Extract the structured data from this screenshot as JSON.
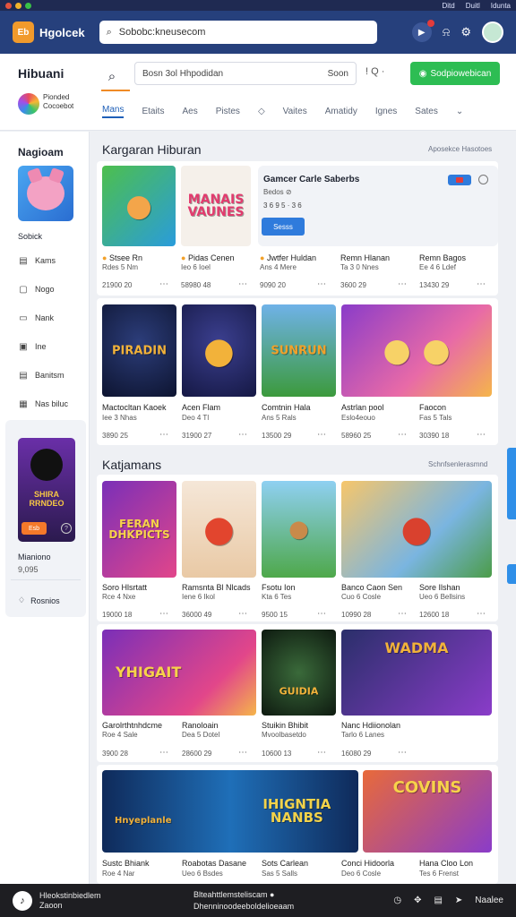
{
  "titlebar": {
    "items": [
      "Ditd",
      "Duitl",
      "Idunta"
    ],
    "traffic": [
      "#e5533d",
      "#f2b32b",
      "#39c047"
    ]
  },
  "topbar": {
    "logo_badge": "Eb",
    "logo_text": "Hgolcek",
    "url": "Sobobc:kneusecom",
    "icons": [
      "play-icon",
      "bell-icon",
      "settings-icon",
      "avatar"
    ]
  },
  "header": {
    "brand": "Hibuani",
    "brand_sub_1": "Pionded",
    "brand_sub_2": "Cocoebot",
    "search_placeholder": "Bosn  3ol  Hhpodidan",
    "search_right": "Soon",
    "mini": "! Q ·",
    "cta": "Sodpiowebican",
    "tabs": [
      "Mans",
      "Etaits",
      "Aes",
      "Pistes",
      "◇",
      "Vaites",
      "Amatidy",
      "Ignes",
      "Sates",
      "⌄"
    ]
  },
  "sidebar": {
    "title": "Nagioam",
    "sub": "Sobick",
    "items": [
      {
        "icon": "grid-icon",
        "glyph": "▤",
        "label": "Kams"
      },
      {
        "icon": "page-icon",
        "glyph": "▢",
        "label": "Nogo"
      },
      {
        "icon": "bookmark-icon",
        "glyph": "▭",
        "label": "Nank"
      },
      {
        "icon": "image-icon",
        "glyph": "▣",
        "label": "Ine"
      },
      {
        "icon": "box-icon",
        "glyph": "▤",
        "label": "Banitsm"
      },
      {
        "icon": "bag-icon",
        "glyph": "▦",
        "label": "Nas biluc"
      }
    ],
    "promo": {
      "title": "SHIRA RRNDEO",
      "button": "Esb",
      "name": "Mianiono",
      "meta": "9,095",
      "feedback": "Rosnios"
    }
  },
  "section1": {
    "title": "Kargaran Hiburan",
    "link": "Aposekce Hasotoes",
    "row1": [
      {
        "title": "Stsee Rn",
        "meta": "Rdes 5 Nm",
        "count": "21900 20",
        "art": "FOX"
      },
      {
        "title": "Pidas Cenen",
        "meta": "Ieo 6 Ioel",
        "count": "58980 48",
        "art": "MANAIS VAUNES"
      },
      {
        "title": "Jwtfer Huldan",
        "meta": "Ans 4 Mere",
        "count": "9090 20",
        "art": ""
      },
      {
        "title": "Remn Hlanan",
        "meta": "Ta 3 0 Nnes",
        "count": "3600 29",
        "art": ""
      },
      {
        "title": "Remn Bagos",
        "meta": "Ee 4 6 Ldef",
        "count": "13430 29",
        "art": ""
      }
    ],
    "featured": {
      "title": "Gamcer Carle Saberbs",
      "sub": "Bedos ⊘",
      "meta": "3 6 9 5 · 3 6",
      "button": "Sesss"
    },
    "row2": [
      {
        "title": "Mactocltan Kaoek",
        "meta": "Iee 3 Nhas",
        "count": "3890 25",
        "art": "PIRADIN"
      },
      {
        "title": "Acen Flam",
        "meta": "Deo 4 Tl",
        "count": "31900 27",
        "art": ""
      },
      {
        "title": "Comtnin Hala",
        "meta": "Ans 5 Rals",
        "count": "13500 29",
        "art": "SUNRUN"
      },
      {
        "title": "Astrlan pool",
        "meta": "Eslo4eouo",
        "count": "58960 25",
        "art": ""
      },
      {
        "title": "Faocon",
        "meta": "Fas 5 Tals",
        "count": "30390 18",
        "art": ""
      }
    ]
  },
  "section2": {
    "title": "Katjamans",
    "link": "Schnfsenlerasmnd",
    "row1": [
      {
        "title": "Soro Hlsrtatt",
        "meta": "Rce 4 Nxe",
        "count": "19000 18",
        "art": "FERAN DHKPICTS"
      },
      {
        "title": "Ramsnta Bl Nlcads",
        "meta": "Iene 6 Ikol",
        "count": "36000 49",
        "art": ""
      },
      {
        "title": "Fsotu Ion",
        "meta": "Kta 6 Tes",
        "count": "9500 15",
        "art": ""
      },
      {
        "title": "Banco Caon Sen",
        "meta": "Cuo 6 Cosle",
        "count": "10990 28",
        "art": ""
      },
      {
        "title": "Sore Ilshan",
        "meta": "Ueo 6 Bellsins",
        "count": "12600 18",
        "art": ""
      }
    ],
    "row2": [
      {
        "title": "Garolrthtnhdcme",
        "meta": "Roe 4 Sale",
        "count": "3900 28",
        "art": "YHIGAIT"
      },
      {
        "title": "Ranoloain",
        "meta": "Dea 5 Dotel",
        "count": "28600 29",
        "art": ""
      },
      {
        "title": "Stuikin Bhibit",
        "meta": "Mvoolbasetdo",
        "count": "10600 13",
        "art": "GUIDIA"
      },
      {
        "title": "Nanc Hdiionolan",
        "meta": "Tarlo 6 Lanes",
        "count": "16080 29",
        "art": "WADMA"
      },
      {
        "title": "",
        "meta": "",
        "count": "",
        "art": ""
      }
    ],
    "row3": [
      {
        "title": "Sustc Bhiank",
        "meta": "Roe 4 Nar",
        "art": "Hnyeplanle"
      },
      {
        "title": "Roabotas Dasane",
        "meta": "Ueo 6 Bsdes",
        "art": "IHIGNTIA NANBS"
      },
      {
        "title": "Sots Carlean",
        "meta": "Sas 5 Salls",
        "art": ""
      },
      {
        "title": "Conci Hidoorla",
        "meta": "Deo 6 Cosle",
        "art": ""
      },
      {
        "title": "Hana Cloo Lon",
        "meta": "Tes 6 Frenst",
        "art": "COVINS"
      }
    ]
  },
  "statusbar": {
    "line1": "Hleokstinbiedlem",
    "line2": "Zaoon",
    "mid1": "Blteahttlemsteliscam ●",
    "mid2": "Dhenninoodeeboldelioeaam",
    "right_label": "Naalee",
    "icons": [
      "chat-icon",
      "nav-icon",
      "calendar-icon",
      "send-icon"
    ]
  },
  "colors": {
    "topbar": "#26407c",
    "accent_green": "#2dbd53",
    "accent_blue": "#2f7bdc",
    "orange": "#f08a25"
  }
}
